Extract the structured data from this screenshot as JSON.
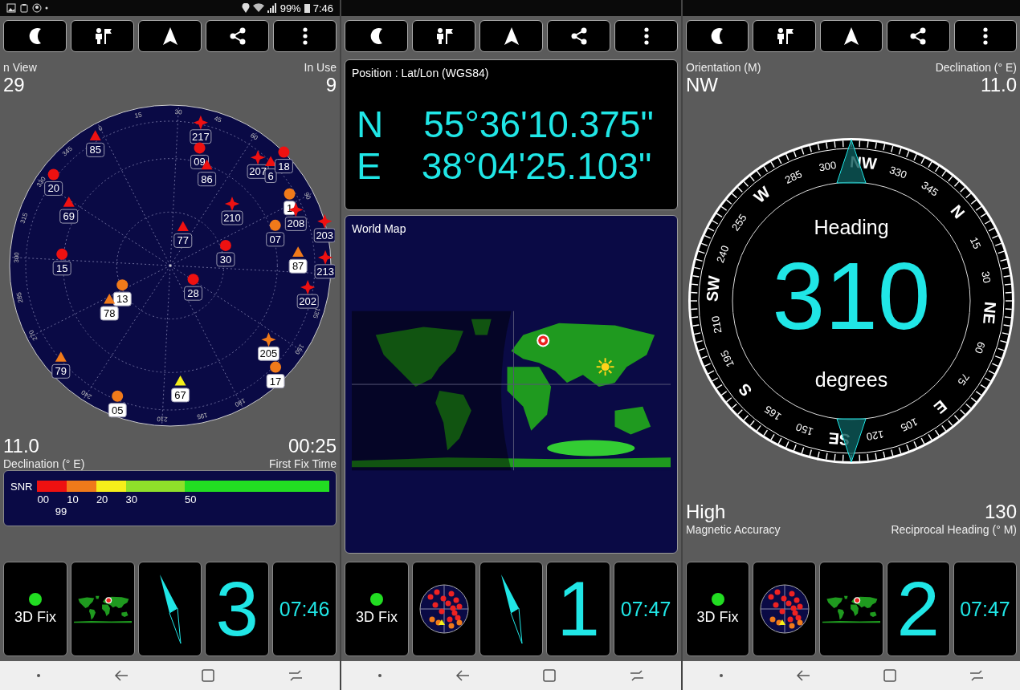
{
  "screens": [
    {
      "kind": "satellites",
      "status_bar": {
        "battery": "99%",
        "time": "7:46"
      },
      "header": [
        {
          "label": "n View",
          "value": "29"
        },
        {
          "label": "In Use",
          "value": "9"
        }
      ],
      "sky_plot": {
        "satellites": [
          {
            "label": "85",
            "kind": "triangle",
            "color": "#ee1111",
            "in_use": false
          },
          {
            "label": "217",
            "kind": "star",
            "color": "#ee1111",
            "in_use": false
          },
          {
            "label": "09",
            "kind": "circle",
            "color": "#ee1111",
            "in_use": false
          },
          {
            "label": "86",
            "kind": "triangle",
            "color": "#ee1111",
            "in_use": false
          },
          {
            "label": "20",
            "kind": "circle",
            "color": "#ee1111",
            "in_use": false
          },
          {
            "label": "69",
            "kind": "triangle",
            "color": "#ee1111",
            "in_use": false
          },
          {
            "label": "207",
            "kind": "star",
            "color": "#ee1111",
            "in_use": false
          },
          {
            "label": "6",
            "kind": "triangle",
            "color": "#ee1111",
            "in_use": false
          },
          {
            "label": "18",
            "kind": "circle",
            "color": "#ee1111",
            "in_use": false
          },
          {
            "label": "1",
            "kind": "circle",
            "color": "#f07a1a",
            "in_use": true
          },
          {
            "label": "210",
            "kind": "star",
            "color": "#ee1111",
            "in_use": false
          },
          {
            "label": "208",
            "kind": "star",
            "color": "#ee1111",
            "in_use": false
          },
          {
            "label": "203",
            "kind": "star",
            "color": "#ee1111",
            "in_use": false
          },
          {
            "label": "77",
            "kind": "triangle",
            "color": "#ee1111",
            "in_use": false
          },
          {
            "label": "07",
            "kind": "circle",
            "color": "#f07a1a",
            "in_use": false
          },
          {
            "label": "15",
            "kind": "circle",
            "color": "#ee1111",
            "in_use": false
          },
          {
            "label": "30",
            "kind": "circle",
            "color": "#ee1111",
            "in_use": false
          },
          {
            "label": "87",
            "kind": "triangle",
            "color": "#f07a1a",
            "in_use": true
          },
          {
            "label": "213",
            "kind": "star",
            "color": "#ee1111",
            "in_use": false
          },
          {
            "label": "28",
            "kind": "circle",
            "color": "#ee1111",
            "in_use": false
          },
          {
            "label": "13",
            "kind": "circle",
            "color": "#f07a1a",
            "in_use": true
          },
          {
            "label": "78",
            "kind": "triangle",
            "color": "#f07a1a",
            "in_use": true
          },
          {
            "label": "202",
            "kind": "star",
            "color": "#ee1111",
            "in_use": false
          },
          {
            "label": "205",
            "kind": "star",
            "color": "#f07a1a",
            "in_use": true
          },
          {
            "label": "79",
            "kind": "triangle",
            "color": "#f07a1a",
            "in_use": false
          },
          {
            "label": "17",
            "kind": "circle",
            "color": "#f07a1a",
            "in_use": true
          },
          {
            "label": "67",
            "kind": "triangle",
            "color": "#f5ef1a",
            "in_use": true
          },
          {
            "label": "05",
            "kind": "circle",
            "color": "#f07a1a",
            "in_use": true
          }
        ],
        "azimuth_labels": [
          "0",
          "15",
          "30",
          "45",
          "60",
          "90",
          "135",
          "150",
          "180",
          "195",
          "210",
          "240",
          "270",
          "285",
          "300",
          "315",
          "330",
          "345"
        ]
      },
      "footer": [
        {
          "value": "11.0",
          "label": "Declination (° E)"
        },
        {
          "value": "00:25",
          "label": "First Fix Time"
        }
      ],
      "snr_legend": {
        "title": "SNR",
        "ticks": [
          "00",
          "10",
          "20",
          "30",
          "50",
          "99"
        ]
      },
      "tiles": [
        {
          "kind": "fix",
          "label": "3D Fix"
        },
        {
          "kind": "map"
        },
        {
          "kind": "compass"
        },
        {
          "kind": "number",
          "text": "3"
        },
        {
          "kind": "time",
          "text": "07:46"
        }
      ]
    },
    {
      "kind": "position",
      "position": {
        "title": "Position : Lat/Lon (WGS84)",
        "rows": [
          {
            "hemisphere": "N",
            "value": "55°36'10.375\""
          },
          {
            "hemisphere": "E",
            "value": "38°04'25.103\""
          }
        ]
      },
      "world_map": {
        "title": "World Map"
      },
      "tiles": [
        {
          "kind": "fix",
          "label": "3D Fix"
        },
        {
          "kind": "sky"
        },
        {
          "kind": "compass"
        },
        {
          "kind": "number",
          "text": "1"
        },
        {
          "kind": "time",
          "text": "07:47"
        }
      ]
    },
    {
      "kind": "compass",
      "header": [
        {
          "label": "Orientation (M)",
          "value": "NW"
        },
        {
          "label": "Declination (° E)",
          "value": "11.0"
        }
      ],
      "compass": {
        "title": "Heading",
        "value": "310",
        "unit": "degrees",
        "dial_labels": [
          {
            "text": "N",
            "kind": "point"
          },
          {
            "text": "15",
            "kind": "degree"
          },
          {
            "text": "30",
            "kind": "degree"
          },
          {
            "text": "NE",
            "kind": "point"
          },
          {
            "text": "60",
            "kind": "degree"
          },
          {
            "text": "75",
            "kind": "degree"
          },
          {
            "text": "E",
            "kind": "point"
          },
          {
            "text": "105",
            "kind": "degree"
          },
          {
            "text": "120",
            "kind": "degree"
          },
          {
            "text": "SE",
            "kind": "point"
          },
          {
            "text": "150",
            "kind": "degree"
          },
          {
            "text": "165",
            "kind": "degree"
          },
          {
            "text": "S",
            "kind": "point"
          },
          {
            "text": "195",
            "kind": "degree"
          },
          {
            "text": "210",
            "kind": "degree"
          },
          {
            "text": "SW",
            "kind": "point"
          },
          {
            "text": "240",
            "kind": "degree"
          },
          {
            "text": "255",
            "kind": "degree"
          },
          {
            "text": "W",
            "kind": "point"
          },
          {
            "text": "285",
            "kind": "degree"
          },
          {
            "text": "300",
            "kind": "degree"
          },
          {
            "text": "NW",
            "kind": "point"
          },
          {
            "text": "330",
            "kind": "degree"
          },
          {
            "text": "345",
            "kind": "degree"
          }
        ]
      },
      "footer": [
        {
          "value": "High",
          "label": "Magnetic Accuracy"
        },
        {
          "value": "130",
          "label": "Reciprocal Heading (° M)"
        }
      ],
      "tiles": [
        {
          "kind": "fix",
          "label": "3D Fix"
        },
        {
          "kind": "sky"
        },
        {
          "kind": "map"
        },
        {
          "kind": "number",
          "text": "2"
        },
        {
          "kind": "time",
          "text": "07:47"
        }
      ]
    }
  ]
}
